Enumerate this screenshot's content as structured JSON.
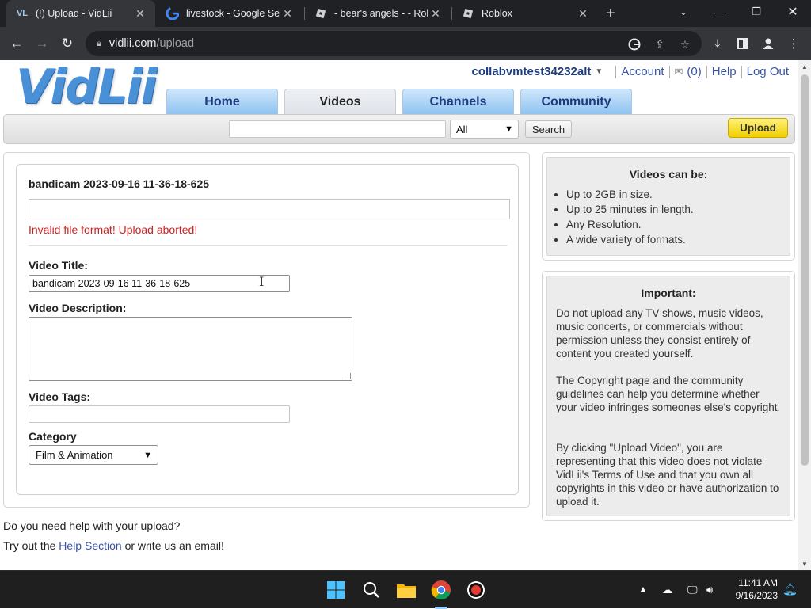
{
  "browser": {
    "tabs": [
      {
        "title": "(!) Upload - VidLii",
        "favicon": "vidlii-icon",
        "active": true
      },
      {
        "title": "livestock - Google Search",
        "favicon": "google-icon",
        "active": false
      },
      {
        "title": "- bear's angels - - Roblox",
        "favicon": "roblox-icon",
        "active": false
      },
      {
        "title": "Roblox",
        "favicon": "roblox-icon",
        "active": false
      }
    ],
    "url_host": "vidlii.com",
    "url_path": "/upload"
  },
  "header": {
    "logo_text": "VidLii",
    "username": "collabvmtest34232alt",
    "account_label": "Account",
    "inbox_count": "(0)",
    "help_label": "Help",
    "logout_label": "Log Out"
  },
  "nav": {
    "tabs": [
      {
        "label": "Home",
        "current": false
      },
      {
        "label": "Videos",
        "current": true
      },
      {
        "label": "Channels",
        "current": false
      },
      {
        "label": "Community",
        "current": false
      }
    ]
  },
  "search": {
    "query": "",
    "category_selected": "All",
    "button_label": "Search",
    "upload_label": "Upload"
  },
  "upload_form": {
    "file_name": "bandicam 2023-09-16 11-36-18-625",
    "upload_progress": 0,
    "error_message": "Invalid file format! Upload aborted!",
    "title_label": "Video Title:",
    "title_value": "bandicam 2023-09-16 11-36-18-625",
    "description_label": "Video Description:",
    "description_value": "",
    "tags_label": "Video Tags:",
    "tags_value": "",
    "category_label": "Category",
    "category_value": "Film & Animation"
  },
  "info_boxes": {
    "videos_can_be": {
      "heading": "Videos can be:",
      "items": [
        "Up to 2GB in size.",
        "Up to 25 minutes in length.",
        "Any Resolution.",
        "A wide variety of formats."
      ]
    },
    "important": {
      "heading": "Important:",
      "paragraphs": [
        "Do not upload any TV shows, music videos, music concerts, or commercials without permission unless they consist entirely of content you created yourself.",
        "The Copyright page and the community guidelines can help you determine whether your video infringes someones else's copyright.",
        "By clicking \"Upload Video\", you are representing that this video does not violate VidLii's Terms of Use and that you own all copyrights in this video or have authorization to upload it."
      ]
    }
  },
  "help": {
    "question": "Do you need help with your upload?",
    "line_prefix": "Try out the",
    "link_label": "Help Section",
    "line_suffix": "or write us an email!"
  },
  "taskbar": {
    "time": "11:41 AM",
    "date": "9/16/2023",
    "apps": [
      "windows-start-icon",
      "search-icon",
      "file-explorer-icon",
      "chrome-icon",
      "recorder-icon"
    ]
  },
  "colors": {
    "chrome_dark": "#202124",
    "chrome_toolbar": "#35363a",
    "nav_tab_blue": "#8ec3f1",
    "link_blue": "#3553a8",
    "error_red": "#d02020",
    "upload_yellow": "#f2cf00",
    "info_panel_gray": "#ececec"
  }
}
